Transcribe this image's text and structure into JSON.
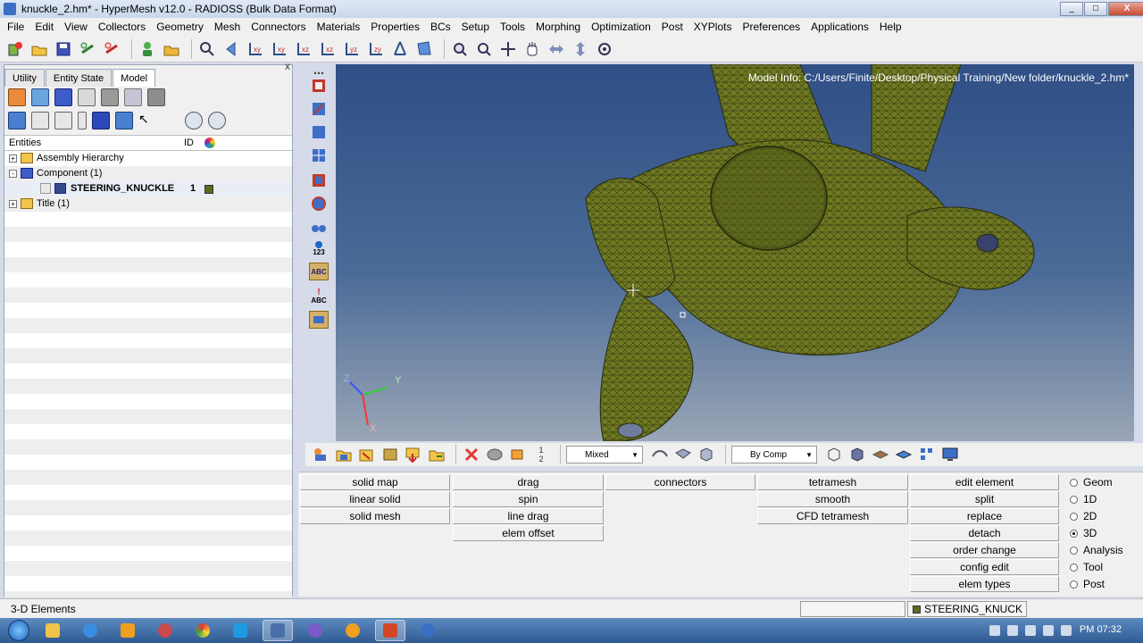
{
  "window": {
    "title": "knuckle_2.hm* - HyperMesh v12.0 - RADIOSS (Bulk Data Format)",
    "min": "_",
    "max": "□",
    "close": "X"
  },
  "menu": [
    "File",
    "Edit",
    "View",
    "Collectors",
    "Geometry",
    "Mesh",
    "Connectors",
    "Materials",
    "Properties",
    "BCs",
    "Setup",
    "Tools",
    "Morphing",
    "Optimization",
    "Post",
    "XYPlots",
    "Preferences",
    "Applications",
    "Help"
  ],
  "left_panel": {
    "tabs": [
      "Utility",
      "Entity State",
      "Model"
    ],
    "active_tab": "Model",
    "close": "x",
    "columns": {
      "entities": "Entities",
      "id": "ID"
    },
    "tree": [
      {
        "label": "Assembly Hierarchy",
        "expander": "+"
      },
      {
        "label": "Component (1)",
        "expander": "-"
      },
      {
        "label": "STEERING_KNUCKLE",
        "id": "1",
        "color": "#5d6b1e"
      },
      {
        "label": "Title (1)",
        "expander": "+"
      }
    ]
  },
  "vertical_tools": {
    "id_label": "123",
    "abc1": "ABC",
    "abc2": "ABC"
  },
  "viewport": {
    "model_info": "Model Info: C:/Users/Finite/Desktop/Physical Training/New folder/knuckle_2.hm*",
    "axis_x": "X",
    "axis_y": "Y",
    "axis_z": "Z",
    "mesh_color": "#6f7a22"
  },
  "bottom_toolbar": {
    "display_mode": "Mixed",
    "color_mode": "By Comp"
  },
  "panel": {
    "col1": [
      "solid map",
      "linear solid",
      "solid mesh"
    ],
    "col2": [
      "drag",
      "spin",
      "line drag",
      "elem offset"
    ],
    "col3": [
      "connectors"
    ],
    "col4": [
      "tetramesh",
      "smooth",
      "CFD tetramesh"
    ],
    "col5": [
      "edit element",
      "split",
      "replace",
      "detach",
      "order change",
      "config edit",
      "elem types"
    ],
    "radios": [
      "Geom",
      "1D",
      "2D",
      "3D",
      "Analysis",
      "Tool",
      "Post"
    ],
    "selected_radio": "3D"
  },
  "status": {
    "message": "3-D Elements",
    "component": "STEERING_KNUCK",
    "component_color": "#5d6b1e"
  },
  "taskbar": {
    "clock": "PM 07:32"
  }
}
